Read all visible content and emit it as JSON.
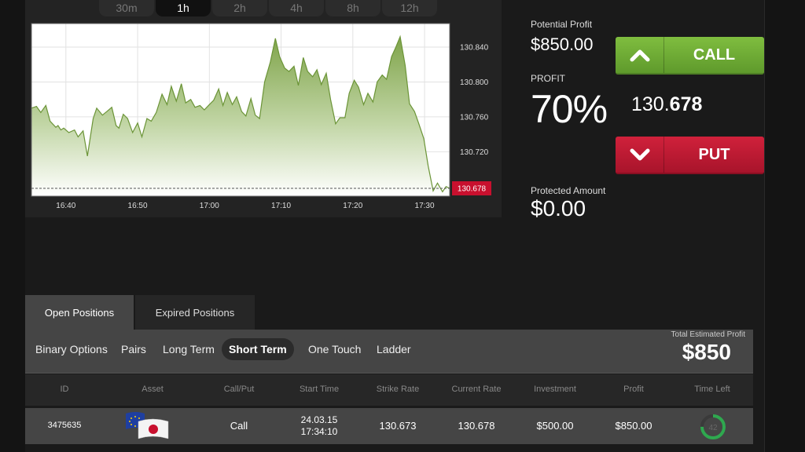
{
  "timeframes": [
    "30m",
    "1h",
    "2h",
    "4h",
    "8h",
    "12h"
  ],
  "active_timeframe": "1h",
  "chart_data": {
    "type": "area",
    "y_ticks": [
      "130.840",
      "130.800",
      "130.760",
      "130.720"
    ],
    "y_tick_values": [
      130.84,
      130.8,
      130.76,
      130.72
    ],
    "ylim": [
      130.669,
      130.867
    ],
    "x_ticks": [
      "16:40",
      "16:50",
      "17:00",
      "17:10",
      "17:20",
      "17:30"
    ],
    "x_tick_minutes": [
      1000,
      1010,
      1020,
      1030,
      1040,
      1050
    ],
    "xlim": [
      995.2,
      1053.5
    ],
    "current_label": "130.678",
    "current_value": 130.678,
    "line_color": "#6b9437",
    "label_color": "#c8102e",
    "x": [
      995.2,
      995.9,
      996.5,
      997.2,
      997.8,
      998.6,
      998.9,
      999.3,
      999.7,
      1000.4,
      1001.2,
      1001.7,
      1002.4,
      1003.0,
      1003.8,
      1004.3,
      1005.1,
      1005.7,
      1006.4,
      1007.0,
      1007.4,
      1008.0,
      1008.6,
      1009.3,
      1010.0,
      1010.6,
      1011.3,
      1011.9,
      1012.6,
      1013.4,
      1014.1,
      1014.7,
      1015.4,
      1016.1,
      1016.7,
      1017.4,
      1018.0,
      1018.7,
      1019.3,
      1020.0,
      1020.6,
      1021.3,
      1021.9,
      1022.5,
      1023.2,
      1023.8,
      1024.5,
      1025.1,
      1025.8,
      1026.4,
      1027.0,
      1027.7,
      1028.5,
      1029.2,
      1029.8,
      1030.5,
      1031.1,
      1031.8,
      1032.4,
      1033.1,
      1033.7,
      1034.4,
      1035.0,
      1035.6,
      1036.3,
      1036.9,
      1037.6,
      1038.2,
      1038.9,
      1039.5,
      1040.2,
      1040.8,
      1041.5,
      1042.1,
      1042.8,
      1043.4,
      1044.1,
      1044.7,
      1045.4,
      1046.0,
      1046.6,
      1047.3,
      1047.9,
      1048.6,
      1049.2,
      1049.9,
      1050.5,
      1051.2,
      1051.8,
      1052.5,
      1053.0,
      1053.5
    ],
    "values": [
      130.77,
      130.772,
      130.765,
      130.773,
      130.755,
      130.748,
      130.75,
      130.745,
      130.747,
      130.742,
      130.745,
      130.737,
      130.744,
      130.715,
      130.758,
      130.77,
      130.762,
      130.766,
      130.771,
      130.75,
      130.747,
      130.763,
      130.758,
      130.742,
      130.753,
      130.737,
      130.758,
      130.755,
      130.765,
      130.786,
      130.774,
      130.795,
      130.778,
      130.798,
      130.776,
      130.78,
      130.771,
      130.773,
      130.768,
      130.774,
      130.779,
      130.792,
      130.773,
      130.788,
      130.774,
      130.783,
      130.766,
      130.761,
      130.781,
      130.762,
      130.758,
      130.8,
      130.823,
      130.85,
      130.829,
      130.816,
      130.812,
      130.818,
      130.796,
      130.828,
      130.812,
      130.806,
      130.814,
      130.797,
      130.81,
      130.78,
      130.752,
      130.759,
      130.759,
      130.787,
      130.802,
      130.794,
      130.774,
      130.787,
      130.777,
      130.8,
      130.808,
      130.803,
      130.829,
      130.84,
      130.852,
      130.819,
      130.775,
      130.766,
      130.752,
      130.735,
      130.704,
      130.675,
      130.684,
      130.674,
      130.68,
      130.678
    ]
  },
  "potential_profit": {
    "label": "Potential Profit",
    "value": "$850.00"
  },
  "profit": {
    "label": "PROFIT",
    "value": "70%"
  },
  "protected_amount": {
    "label": "Protected Amount",
    "value": "$0.00"
  },
  "rate": {
    "prefix": "130.",
    "bold": "678"
  },
  "call": {
    "label": "CALL",
    "icon": "chevron-up-icon"
  },
  "put": {
    "label": "PUT",
    "icon": "chevron-down-icon"
  },
  "tabs": {
    "open": "Open Positions",
    "expired": "Expired Positions"
  },
  "filters": [
    "Binary Options",
    "Pairs",
    "Long Term",
    "Short Term",
    "One Touch",
    "Ladder"
  ],
  "active_filter": "Short Term",
  "total_estimated_profit": {
    "label": "Total Estimated Profit",
    "value": "$850"
  },
  "columns": [
    "ID",
    "Asset",
    "Call/Put",
    "Start Time",
    "Strike Rate",
    "Current Rate",
    "Investment",
    "Profit",
    "Time Left"
  ],
  "row": {
    "id": "3475635",
    "asset_icons": [
      "eu-flag-icon",
      "japan-flag-icon"
    ],
    "call_put": "Call",
    "start_date": "24.03.15",
    "start_time": "17:34:10",
    "strike_rate": "130.673",
    "current_rate": "130.678",
    "investment": "$500.00",
    "profit": "$850.00",
    "time_left": "42",
    "time_left_fraction": 0.75
  },
  "colors": {
    "call": "#72b236",
    "put": "#c0182f",
    "timer": "#2fa84f"
  }
}
